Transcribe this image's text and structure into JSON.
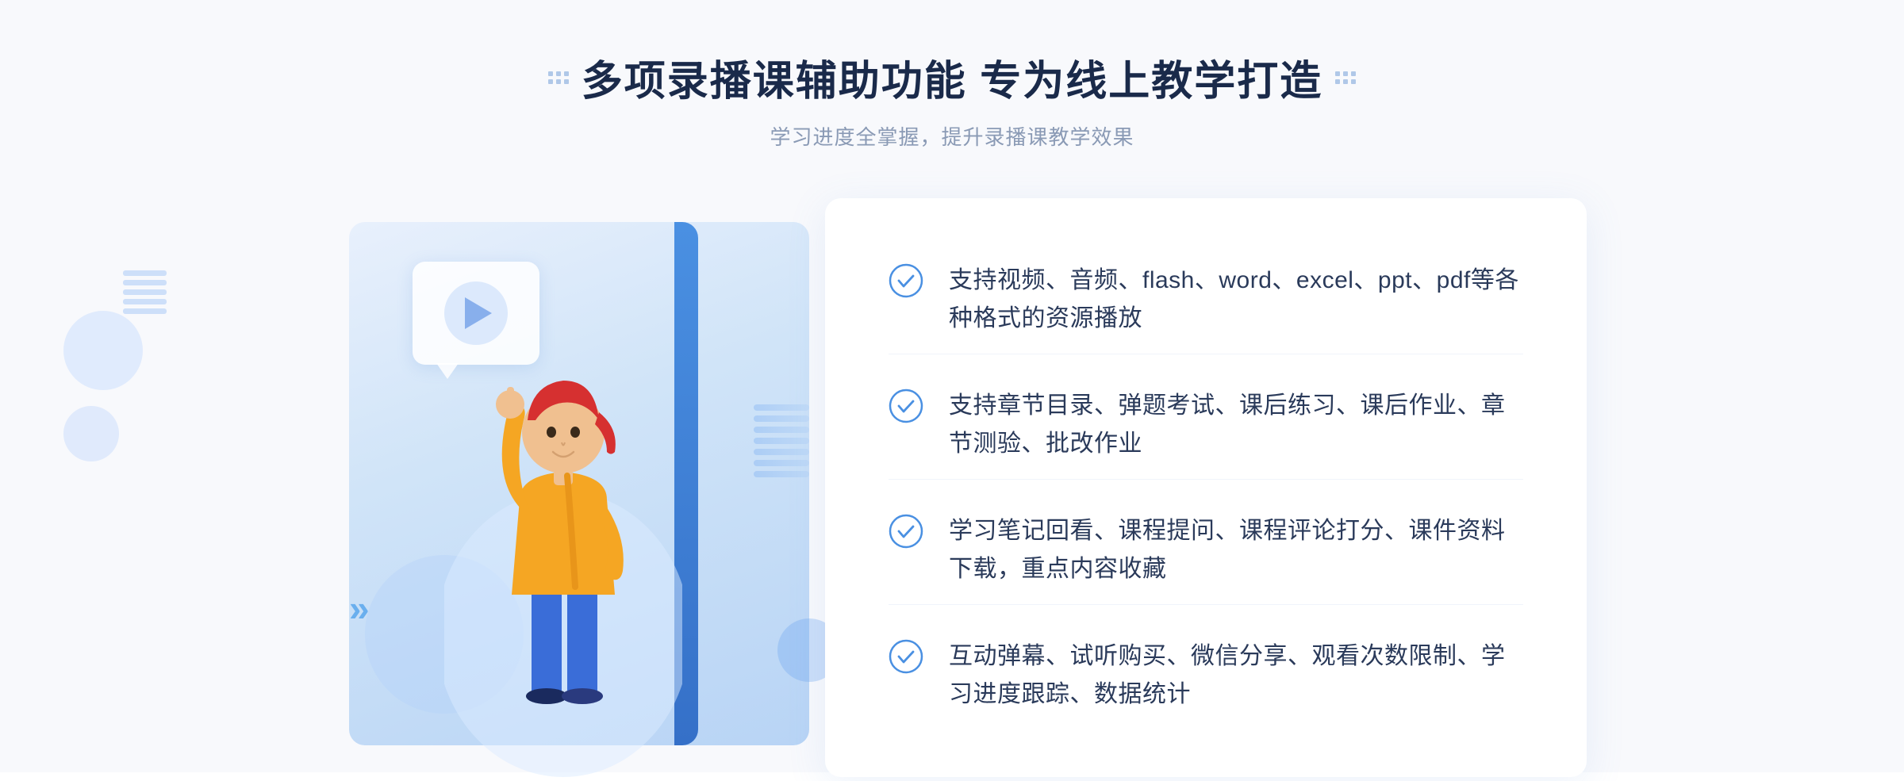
{
  "header": {
    "title": "多项录播课辅助功能 专为线上教学打造",
    "subtitle": "学习进度全掌握，提升录播课教学效果"
  },
  "features": [
    {
      "id": 1,
      "text": "支持视频、音频、flash、word、excel、ppt、pdf等各种格式的资源播放"
    },
    {
      "id": 2,
      "text": "支持章节目录、弹题考试、课后练习、课后作业、章节测验、批改作业"
    },
    {
      "id": 3,
      "text": "学习笔记回看、课程提问、课程评论打分、课件资料下载，重点内容收藏"
    },
    {
      "id": 4,
      "text": "互动弹幕、试听购买、微信分享、观看次数限制、学习进度跟踪、数据统计"
    }
  ],
  "decoration": {
    "left_arrows": "»",
    "check_color": "#4a90e2",
    "accent_color": "#3570c8"
  }
}
